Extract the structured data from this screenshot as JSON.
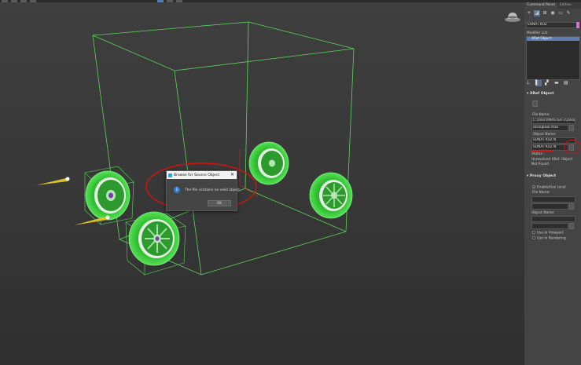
{
  "dialog": {
    "title": "Browse for Source Object",
    "message": "The file contains no valid object.",
    "ok_label": "OK",
    "close_glyph": "✕"
  },
  "command_panel": {
    "tabs": [
      "Command Panel",
      "Edition"
    ],
    "object_name": "SONAT KUZ",
    "modifier_list_label": "Modifier List",
    "stack_item": "XRef Object",
    "xref_rollout": {
      "title": "XRef Object",
      "file_name_label": "File Name:",
      "file_path": "C:\\Users\\MASTER-2\\Deskto",
      "file_short": "исходник.max",
      "object_name_label": "Object Name:",
      "object_name_value": "SONAT KUZ N",
      "object_name_field": "SONAT KUZ N",
      "status_label": "Status :",
      "status_text": "Unresolved XRef, Object Not Found"
    },
    "proxy_rollout": {
      "title": "Proxy Object",
      "enable_label": "Enable/Use Local",
      "file_name_label": "File Name:",
      "object_name_label": "Object Name:",
      "use_viewport_label": "Use In Viewport",
      "use_rendering_label": "Use In Rendering"
    }
  },
  "colors": {
    "wire_box": "#5fd35f",
    "wheel_fill": "#36c936",
    "red_annotation": "#d11414",
    "accent_selection": "#5b7fb0"
  }
}
